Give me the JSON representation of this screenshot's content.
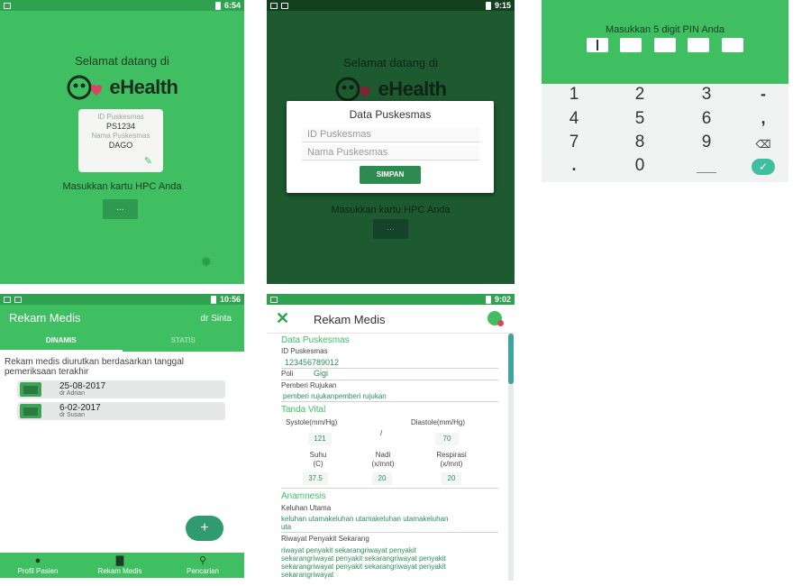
{
  "welcome": {
    "greeting": "Selamat datang di",
    "app_name": "eHealth",
    "time": "6:54",
    "card": {
      "id_label": "ID Puskesmas",
      "id_value": "PS1234",
      "name_label": "Nama Puskesmas",
      "name_value": "DAGO"
    },
    "hint": "Masukkan kartu HPC Anda",
    "button_label": "..."
  },
  "setup_dialog": {
    "time": "9:15",
    "greeting": "Selamat datang di",
    "app_name": "eHealth",
    "hint": "Masukkan kartu HPC Anda",
    "button_label": "...",
    "title": "Data Puskesmas",
    "id_placeholder": "ID Puskesmas",
    "name_placeholder": "Nama Puskesmas",
    "save_label": "SIMPAN"
  },
  "pin": {
    "title": "Masukkan 5 digit PIN Anda",
    "keys": [
      "1",
      "2",
      "3",
      "-",
      "4",
      "5",
      "6",
      ",",
      "7",
      "8",
      "9",
      "⌫",
      ".",
      "0",
      "",
      "✓"
    ]
  },
  "records": {
    "time": "10:56",
    "title": "Rekam Medis",
    "user": "dr Sinta",
    "tabs": [
      "DINAMIS",
      "STATIS"
    ],
    "note": "Rekam medis diurutkan berdasarkan tanggal pemeriksaan terakhir",
    "items": [
      {
        "date": "25-08-2017",
        "doctor": "dr Adrian"
      },
      {
        "date": "6-02-2017",
        "doctor": "dr Susan"
      }
    ],
    "fab_label": "+",
    "nav": [
      "Profil Pasien",
      "Rekam Medis",
      "Pencarian"
    ]
  },
  "detail": {
    "time": "9:02",
    "title": "Rekam Medis",
    "data_puskesmas": {
      "section": "Data Puskesmas",
      "id_label": "ID Puskesmas",
      "id_value": "123456789012",
      "poli_label": "Poli",
      "poli_value": "Gigi",
      "rujukan_label": "Pemberi Rujukan",
      "rujukan_value": "pemberi rujukanpemberi rujukan"
    },
    "vital": {
      "section": "Tanda Vital",
      "systole_label": "Systole(mm/Hg)",
      "diastole_label": "Diastole(mm/Hg)",
      "systole": "121",
      "separator": "/",
      "diastole": "70",
      "suhu_label": "Suhu",
      "suhu_unit": "(C)",
      "nadi_label": "Nadi",
      "nadi_unit": "(x/mnt)",
      "respirasi_label": "Respirasi",
      "respirasi_unit": "(x/mnt)",
      "suhu": "37.5",
      "nadi": "20",
      "respirasi": "20"
    },
    "anamnesis": {
      "section": "Anamnesis",
      "keluhan_label": "Keluhan Utama",
      "keluhan_value": "keluhan utamakeluhan utamakeluhan utamakeluhan uta",
      "riwayat_label": "Riwayat Penyakit Sekarang",
      "riwayat_value": "riwayat penyakit sekarangriwayat penyakit sekarangriwayat penyakit sekarangriwayat penyakit sekarangriwayat penyakit sekarangriwayat penyakit sekarangriwayat"
    }
  }
}
